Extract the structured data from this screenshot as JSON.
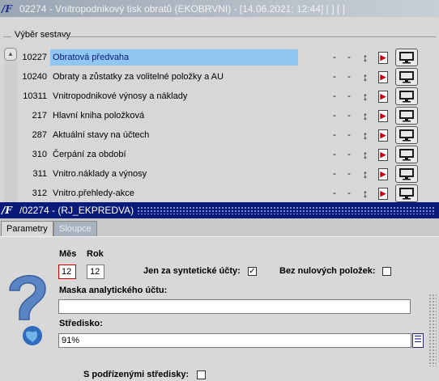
{
  "bg_window": {
    "title": "02274 - Vnitropodnikový tisk obratů (EKOBRVNI) - [14.06.2021; 12:44]  [ ]  [ ]",
    "group_label": "Výběr sestavy"
  },
  "reports": [
    {
      "code": "10227",
      "name": "Obratová předvaha",
      "dash1": "-",
      "dash2": "-"
    },
    {
      "code": "10240",
      "name": "Obraty a zůstatky za volitelné položky a AU",
      "dash1": "-",
      "dash2": "-"
    },
    {
      "code": "10311",
      "name": "Vnitropodnikové výnosy a náklady",
      "dash1": "-",
      "dash2": "-"
    },
    {
      "code": "217",
      "name": "Hlavní kniha položková",
      "dash1": "-",
      "dash2": "-"
    },
    {
      "code": "287",
      "name": "Aktuální stavy na účtech",
      "dash1": "-",
      "dash2": "-"
    },
    {
      "code": "310",
      "name": "Čerpání za období",
      "dash1": "-",
      "dash2": "-"
    },
    {
      "code": "311",
      "name": "Vnitro.náklady a výnosy",
      "dash1": "-",
      "dash2": "-"
    },
    {
      "code": "312",
      "name": "Vnitro.přehledy-akce",
      "dash1": "-",
      "dash2": "-"
    }
  ],
  "dialog": {
    "title": "/02274 - (RJ_EKPREDVA)",
    "tabs": [
      "Parametry",
      "Sloupce"
    ],
    "mes_label": "Měs",
    "rok_label": "Rok",
    "mes_value": "12",
    "rok_value": "12",
    "synt_label": "Jen za syntetické účty:",
    "synt_checked": "✓",
    "nulove_label": "Bez nulových položek:",
    "maska_label": "Maska analytického účtu:",
    "maska_value": "",
    "stredisko_label": "Středisko:",
    "stredisko_value": "91%",
    "podrizene_label": "S podřízenými středisky:"
  },
  "icons": {
    "arrow": "↕",
    "pdf": "pdf-icon",
    "monitor": "monitor-icon",
    "help": "question-globe-icon"
  },
  "colors": {
    "selected_row": "#8fc7f2",
    "dialog_title": "#0a1a7a",
    "error_border": "#d10000"
  }
}
